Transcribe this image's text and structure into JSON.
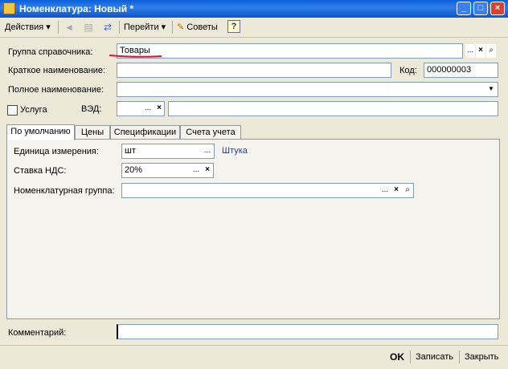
{
  "window": {
    "title": "Номенклатура: Новый *",
    "controls": {
      "minimize": "_",
      "maximize": "□",
      "close": "×"
    }
  },
  "toolbar": {
    "actions_label": "Действия",
    "goto_label": "Перейти",
    "tips_label": "Советы",
    "help_label": "?",
    "dropdown_glyph": "▾"
  },
  "form": {
    "group": {
      "label": "Группа справочника:",
      "value": "Товары"
    },
    "short_name": {
      "label": "Краткое наименование:",
      "value": ""
    },
    "code": {
      "label": "Код:",
      "value": "000000003"
    },
    "full_name": {
      "label": "Полное наименование:",
      "value": ""
    },
    "service": {
      "label": "Услуга",
      "checked": false
    },
    "ved": {
      "label": "ВЭД:",
      "value": ""
    },
    "comment": {
      "label": "Комментарий:",
      "value": ""
    }
  },
  "tabs": [
    "По умолчанию",
    "Цены",
    "Спецификации",
    "Счета учета"
  ],
  "defaults_tab": {
    "unit": {
      "label": "Единица измерения:",
      "value": "шт",
      "full": "Штука"
    },
    "vat": {
      "label": "Ставка НДС:",
      "value": "20%"
    },
    "nom_group": {
      "label": "Номенклатурная группа:",
      "value": ""
    }
  },
  "buttons": {
    "ok": "OK",
    "save": "Записать",
    "close": "Закрыть"
  },
  "glyphs": {
    "ellipsis": "...",
    "clear": "×",
    "search": "⌕",
    "dropdown": "▼"
  },
  "colors": {
    "title_bar": "#0A5FD8",
    "background": "#ECE9D8",
    "annotation": "#E0102F",
    "link_text": "#1F3F9F"
  }
}
